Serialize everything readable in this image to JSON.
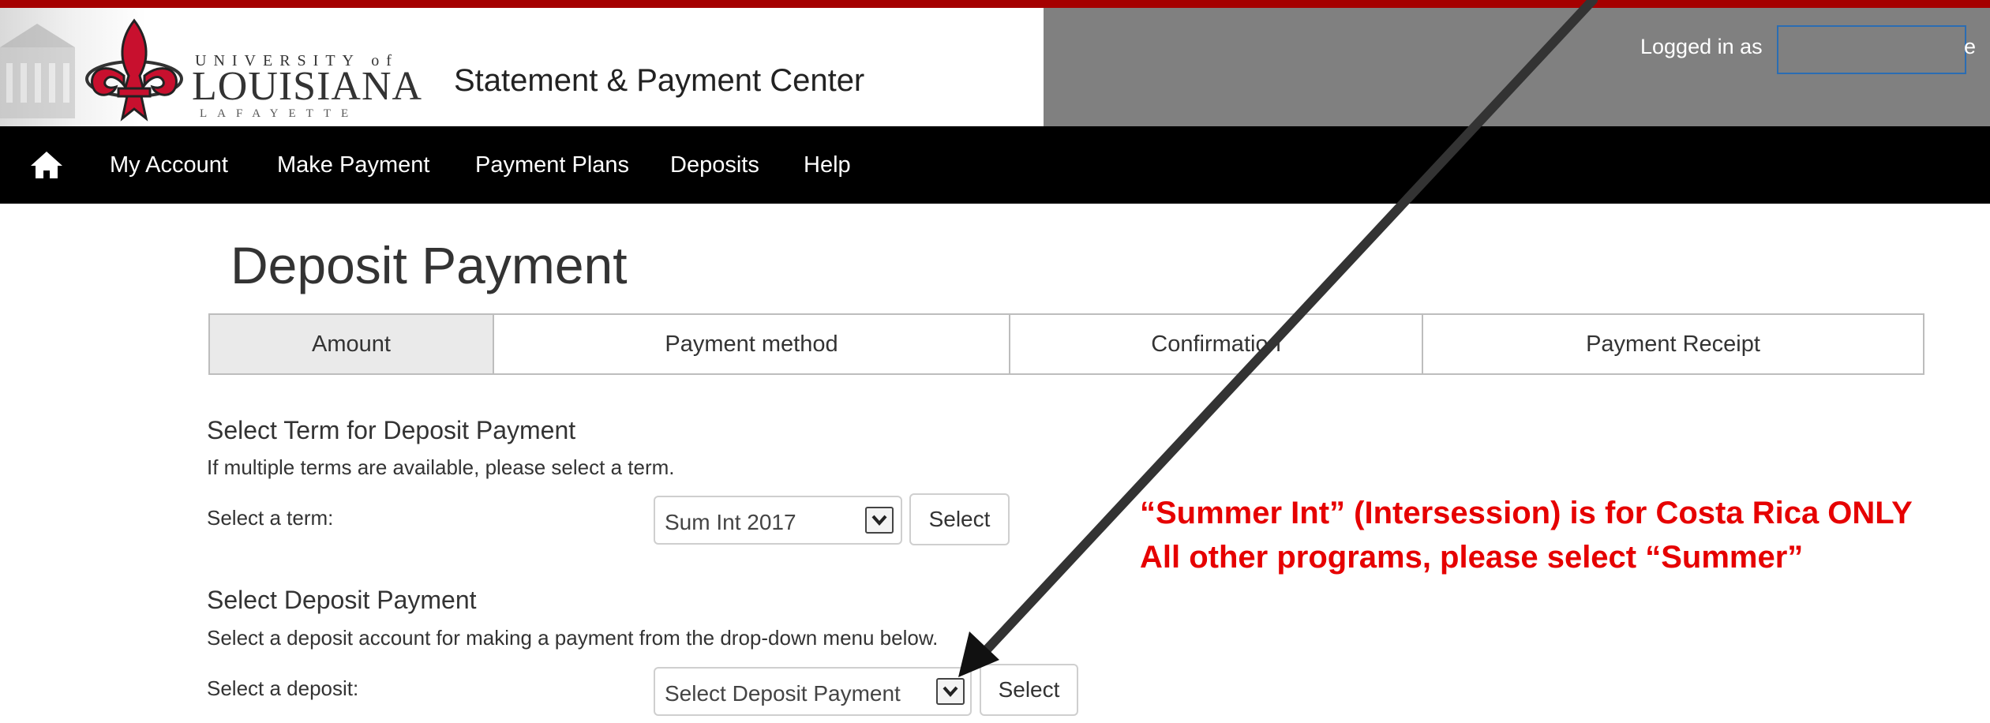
{
  "header": {
    "university_top": "UNIVERSITY of",
    "university_name": "LOUISIANA",
    "university_bottom": "LAFAYETTE",
    "app_title": "Statement & Payment Center",
    "logged_in_label": "Logged in as",
    "logged_in_tail": "e",
    "brand_color": "#a50000"
  },
  "nav": {
    "home_icon": "home-icon",
    "items": [
      "My Account",
      "Make Payment",
      "Payment Plans",
      "Deposits",
      "Help"
    ]
  },
  "page": {
    "title": "Deposit Payment",
    "steps": [
      "Amount",
      "Payment method",
      "Confirmation",
      "Payment Receipt"
    ],
    "active_step": "Amount"
  },
  "term_section": {
    "title": "Select Term for Deposit Payment",
    "help": "If multiple terms are available, please select a term.",
    "label": "Select a term:",
    "selected": "Sum Int 2017",
    "button": "Select"
  },
  "deposit_section": {
    "title": "Select Deposit Payment",
    "help": "Select a deposit account for making a payment from the drop-down menu below.",
    "label": "Select a deposit:",
    "selected": "Select Deposit Payment",
    "button": "Select"
  },
  "annotation": {
    "line1": "“Summer Int” (Intersession) is for Costa Rica ONLY",
    "line2": "All other programs, please select “Summer”",
    "color": "#e60000"
  }
}
